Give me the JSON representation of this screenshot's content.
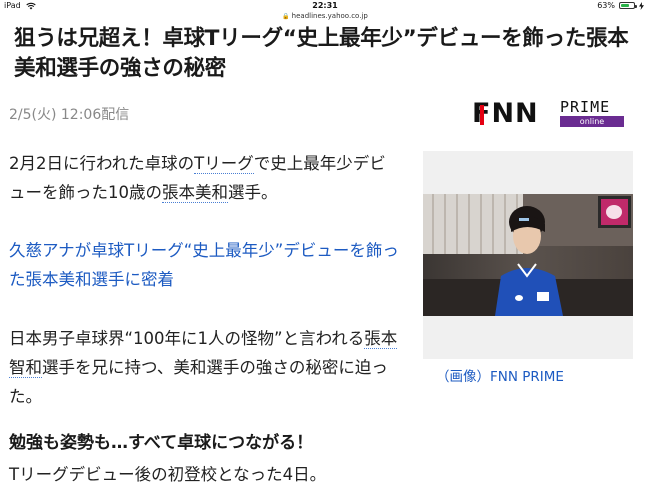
{
  "status_bar": {
    "device": "iPad",
    "time": "22:31",
    "battery_percent": "63%",
    "battery_level": 0.63
  },
  "url_bar": {
    "url": "headlines.yahoo.co.jp"
  },
  "article": {
    "headline_line1": "狙うは兄超え！卓球Tリーグ“史上最年少”デビューを飾った張本",
    "headline_line2": "美和選手の強さの秘密",
    "date": "2/5(火) 12:06配信",
    "logo": {
      "brand": "FNN",
      "prime": "PRIME",
      "online": "online",
      "accent_color": "#e50012",
      "online_color": "#6a2c91"
    },
    "p1": {
      "a": "2月2日に行われた卓球の",
      "b": "Tリーグ",
      "c": "で史上最年少デビ",
      "d": "ューを飾った10歳の",
      "e": "張本美和",
      "f": "選手。"
    },
    "p2": {
      "line1": "久慈アナが卓球Tリーグ“史上最年少”デビューを飾っ",
      "line2": "た張本美和選手に密着"
    },
    "p3": {
      "a": "日本男子卓球界“100年に1人の怪物”と言われる",
      "b": "張本",
      "c": "智和",
      "d": "選手を兄に持つ、美和選手の強さの秘密に迫っ",
      "e": "た。"
    },
    "subhead": "勉強も姿勢も…すべて卓球につながる！",
    "p4": "Tリーグデビュー後の初登校となった4日。",
    "photo_caption": "（画像）FNN PRIME"
  }
}
